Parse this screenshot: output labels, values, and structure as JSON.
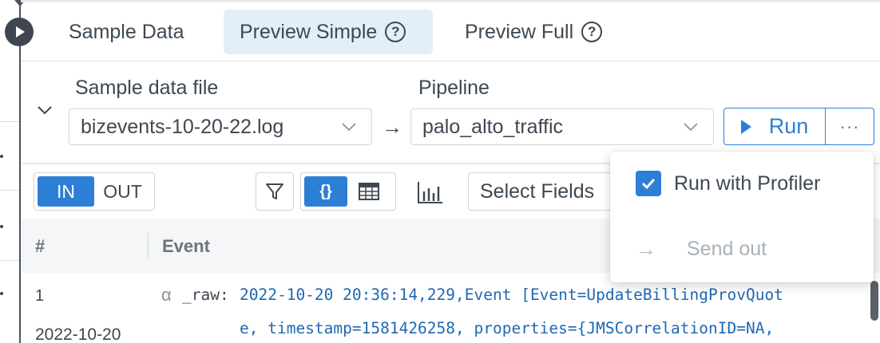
{
  "tabs": [
    {
      "label": "Sample Data",
      "active": false,
      "help": false
    },
    {
      "label": "Preview Simple",
      "active": true,
      "help": true
    },
    {
      "label": "Preview Full",
      "active": false,
      "help": true
    }
  ],
  "help_glyph": "?",
  "sample_file": {
    "label": "Sample data file",
    "value": "bizevents-10-20-22.log"
  },
  "pipeline": {
    "label": "Pipeline",
    "value": "palo_alto_traffic"
  },
  "run_button": {
    "label": "Run"
  },
  "more_button": {
    "label": "···"
  },
  "toggle": {
    "in_label": "IN",
    "out_label": "OUT",
    "selected": "IN"
  },
  "view_toggle": {
    "json_label": "{}"
  },
  "select_fields": {
    "label": "Select Fields"
  },
  "table": {
    "headers": {
      "num": "#",
      "event": "Event"
    },
    "row": {
      "num": "1",
      "time": "2022-10-20",
      "type_glyph": "α",
      "key": "_raw:",
      "lines": [
        "2022-10-20 20:36:14,229,Event [Event=UpdateBillingProvQuot",
        "e, timestamp=1581426258, properties={JMSCorrelationID=NA,"
      ]
    }
  },
  "menu": {
    "profiler": {
      "label": "Run with Profiler",
      "checked": true
    },
    "send_out": {
      "label": "Send out",
      "enabled": false
    }
  },
  "colors": {
    "accent": "#2d7fd6",
    "text": "#3d4852",
    "code": "#1f68b3",
    "active_tab_bg": "#e2eff9"
  }
}
